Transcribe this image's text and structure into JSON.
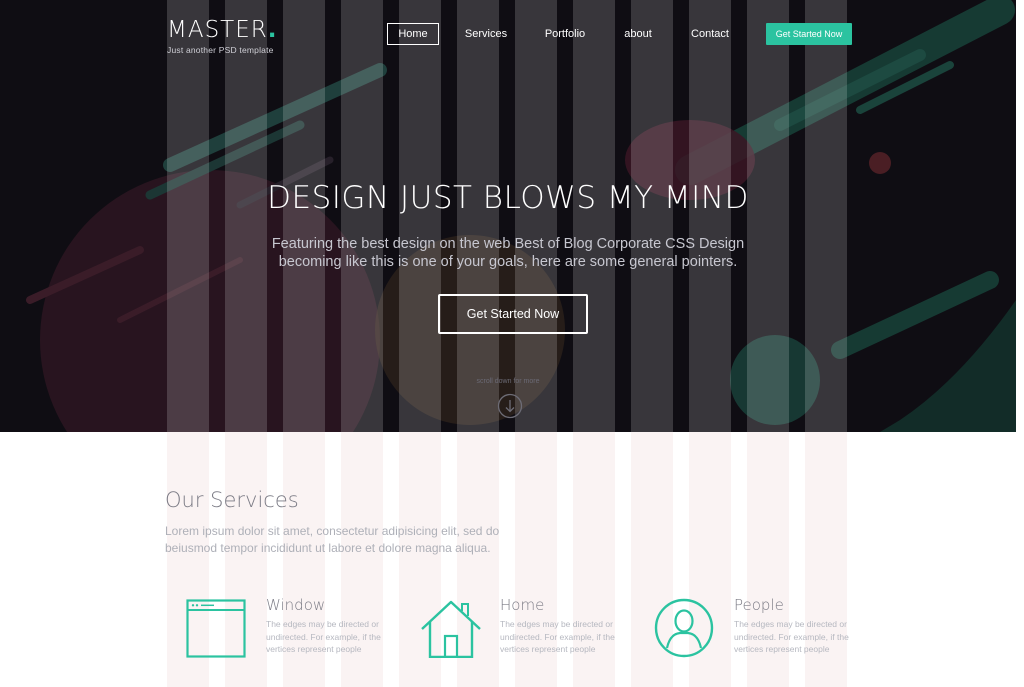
{
  "brand": {
    "name": "MASTER",
    "dot": ".",
    "tagline": "Just another PSD template",
    "accent": "#2bc3a0"
  },
  "nav": {
    "items": [
      {
        "label": "Home",
        "active": true
      },
      {
        "label": "Services",
        "active": false
      },
      {
        "label": "Portfolio",
        "active": false
      },
      {
        "label": "about",
        "active": false
      },
      {
        "label": "Contact",
        "active": false
      }
    ],
    "cta_label": "Get Started Now"
  },
  "hero": {
    "title": "DESIGN JUST BLOWS MY MIND",
    "subtitle_line1": "Featuring the best design on the web Best of Blog Corporate CSS Design",
    "subtitle_line2": "becoming like this is one of your goals, here are some general pointers.",
    "cta_label": "Get Started Now",
    "scroll_label": "scroll down for more",
    "scroll_icon": "arrow-down-circle-icon"
  },
  "services": {
    "title": "Our Services",
    "desc_line1": "Lorem ipsum dolor sit amet, consectetur adipisicing elit, sed do",
    "desc_line2": "beiusmod tempor incididunt ut labore et dolore magna aliqua.",
    "cards": [
      {
        "icon": "window-icon",
        "title": "Window",
        "text": "The edges may be directed or undirected. For example, if the vertices represent people"
      },
      {
        "icon": "home-icon",
        "title": "Home",
        "text": "The edges may be directed or undirected. For example, if the vertices represent people"
      },
      {
        "icon": "people-icon",
        "title": "People",
        "text": "The edges may be directed or undirected. For example, if the vertices represent people"
      }
    ]
  }
}
